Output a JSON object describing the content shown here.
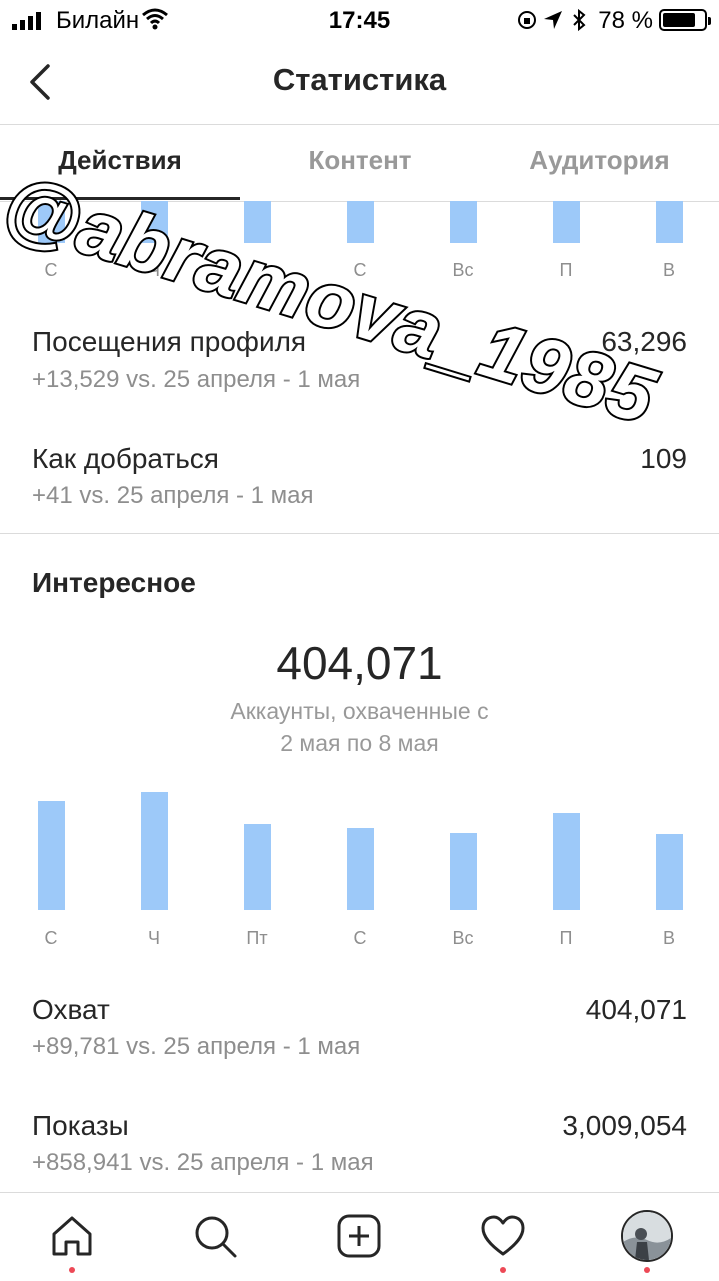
{
  "status_bar": {
    "carrier": "Билайн",
    "time": "17:45",
    "battery_percent": "78 %",
    "battery_level": 0.78
  },
  "header": {
    "title": "Статистика"
  },
  "tabs": [
    {
      "label": "Действия",
      "active": true
    },
    {
      "label": "Контент",
      "active": false
    },
    {
      "label": "Аудитория",
      "active": false
    }
  ],
  "top_chart": {
    "days": [
      "С",
      "Ч",
      "",
      "С",
      "Вс",
      "П",
      "В"
    ]
  },
  "activity_rows": [
    {
      "label": "Посещения профиля",
      "sub": "+13,529 vs. 25 апреля - 1 мая",
      "value": "63,296"
    },
    {
      "label": "Как добраться",
      "sub": "+41 vs. 25 апреля - 1 мая",
      "value": "109"
    }
  ],
  "discovery": {
    "section_title": "Интересное",
    "big_number": "404,071",
    "caption_line1": "Аккаунты, охваченные с",
    "caption_line2": "2 мая по 8 мая",
    "chart_data": {
      "type": "bar",
      "categories": [
        "С",
        "Ч",
        "Пт",
        "С",
        "Вс",
        "П",
        "В"
      ],
      "values": [
        100,
        108,
        79,
        75,
        71,
        89,
        70
      ],
      "ylim": [
        0,
        110
      ],
      "color": "#9dc9f9"
    },
    "rows": [
      {
        "label": "Охват",
        "sub": "+89,781 vs. 25 апреля - 1 мая",
        "value": "404,071"
      },
      {
        "label": "Показы",
        "sub": "+858,941 vs. 25 апреля - 1 мая",
        "value": "3,009,054"
      }
    ]
  },
  "watermark": "@abramova_1985",
  "nav": [
    "home-icon",
    "search-icon",
    "add-post-icon",
    "activity-heart-icon",
    "profile-avatar"
  ],
  "colors": {
    "accent_bar": "#9dc9f9",
    "notification_dot": "#ed4956"
  }
}
